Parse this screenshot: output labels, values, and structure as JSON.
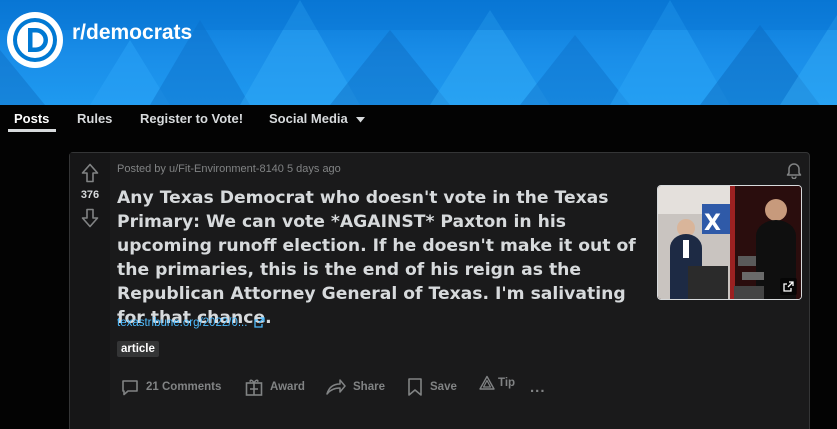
{
  "subreddit": {
    "name": "r/democrats",
    "logo_letter": "D",
    "colors": {
      "banner": "#1a8ee9",
      "accent": "#0079d3"
    }
  },
  "nav": {
    "items": [
      {
        "label": "Posts",
        "active": true
      },
      {
        "label": "Rules"
      },
      {
        "label": "Register to Vote!"
      },
      {
        "label": "Social Media",
        "dropdown": true
      }
    ]
  },
  "post": {
    "score": "376",
    "meta": "Posted by u/Fit-Environment-8140 5 days ago",
    "title": "Any Texas Democrat who doesn't vote in the Texas Primary: We can vote *AGAINST* Paxton in his upcoming runoff election. If he doesn't make it out of the primaries, this is the end of his reign as the Republican Attorney General of Texas. I'm salivating for that chance.",
    "link_text": "texastribune.org/2022/0...",
    "flair": "article",
    "actions": {
      "comments": "21 Comments",
      "award": "Award",
      "share": "Share",
      "save": "Save",
      "tip": "Tip",
      "more": "..."
    },
    "icons": [
      "upvote-icon",
      "downvote-icon",
      "bell-icon",
      "external-link-icon",
      "comment-icon",
      "award-icon",
      "share-icon",
      "save-icon",
      "tip-icon"
    ]
  }
}
